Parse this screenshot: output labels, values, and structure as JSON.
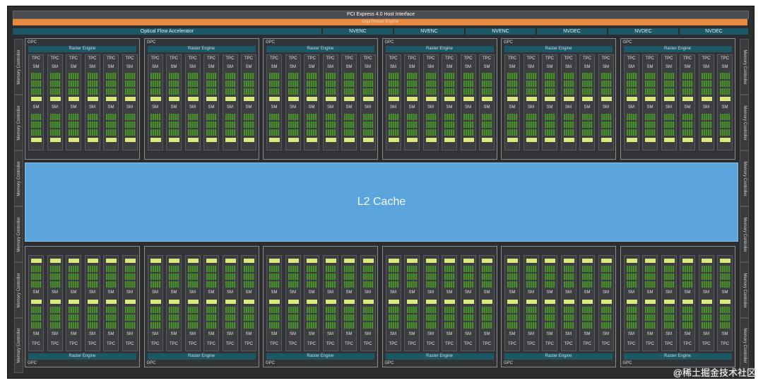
{
  "header": {
    "pcie": "PCI Express 4.0 Host Interface",
    "gigathread": "GigaThread Engine"
  },
  "accelerators": {
    "optical_flow": "Optical Flow Accelerator",
    "items": [
      "NVENC",
      "NVENC",
      "NVENC",
      "NVDEC",
      "NVDEC",
      "NVDEC"
    ]
  },
  "memory_controller_label": "Memory Controller",
  "gpc": {
    "label": "GPC",
    "raster_engine": "Raster Engine",
    "tpc_label": "TPC",
    "sm_label": "SM",
    "count_per_row": 6,
    "tpcs_per_gpc": 6
  },
  "l2_cache": "L2 Cache",
  "watermark": "@稀土掘金技术社区",
  "colors": {
    "frame": "#2c2d2f",
    "gigathread": "#e8893d",
    "accelerator": "#1d5866",
    "l2_cache": "#5ba5dc",
    "sm_core": "#4f8a35",
    "l1_cache": "#dbe97c"
  }
}
